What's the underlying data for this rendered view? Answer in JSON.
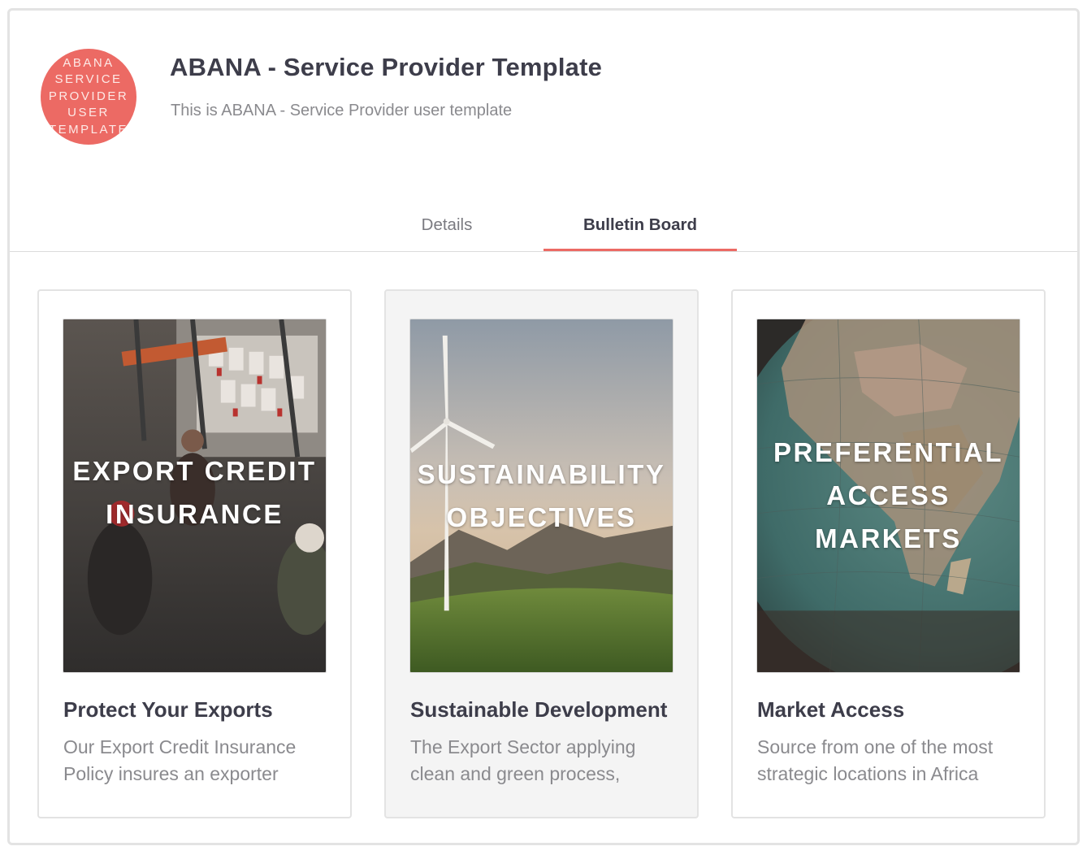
{
  "header": {
    "logo_lines": [
      "ABANA",
      "SERVICE",
      "PROVIDER",
      "USER",
      "TEMPLATE"
    ],
    "title": "ABANA - Service Provider Template",
    "subtitle": "This is ABANA - Service Provider user template"
  },
  "tabs": [
    {
      "label": "Details",
      "active": false
    },
    {
      "label": "Bulletin Board",
      "active": true
    }
  ],
  "cards": [
    {
      "image_lines": [
        "EXPORT CREDIT",
        "INSURANCE"
      ],
      "title": "Protect Your Exports",
      "description": "Our Export Credit Insurance Policy insures an exporter"
    },
    {
      "image_lines": [
        "SUSTAINABILITY",
        "OBJECTIVES"
      ],
      "title": "Sustainable Development",
      "description": "The Export Sector applying clean and green process,"
    },
    {
      "image_lines": [
        "PREFERENTIAL",
        "ACCESS",
        "MARKETS"
      ],
      "title": "Market Access",
      "description": "Source from one of the most strategic locations in Africa"
    }
  ],
  "colors": {
    "accent": "#ec6a64",
    "title_text": "#3d3d4a",
    "muted_text": "#8a8a8e"
  }
}
